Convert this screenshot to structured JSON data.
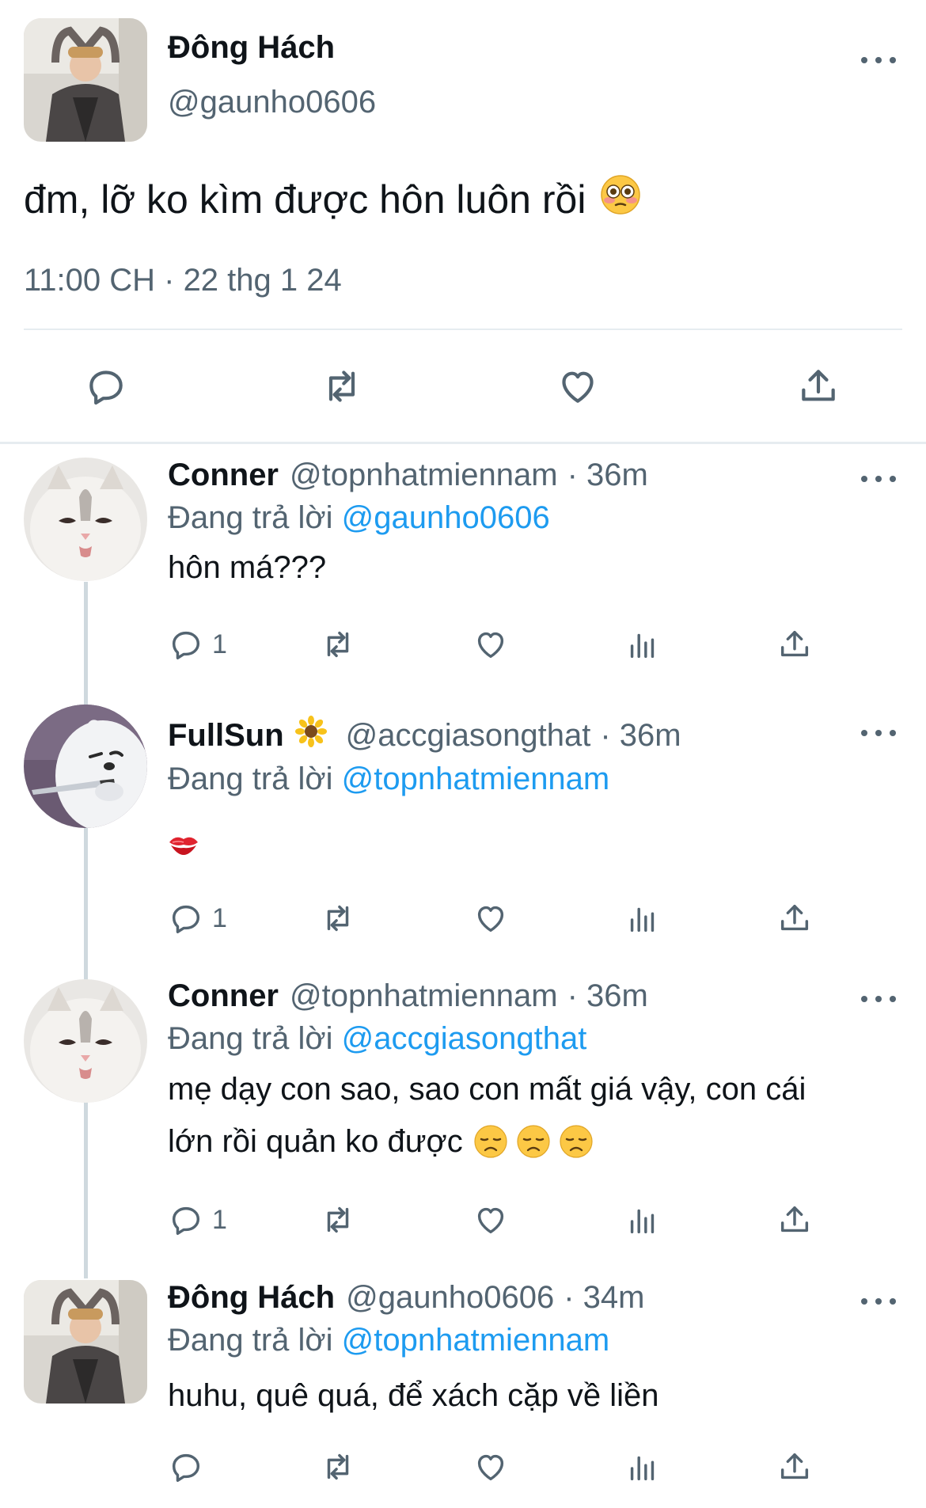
{
  "main_tweet": {
    "display_name": "Đông Hách",
    "handle": "@gaunho0606",
    "text": "đm, lỡ ko kìm được hôn luôn rồi",
    "emoji": "flushed-face",
    "timestamp": "11:00 CH · 22 thg 1 24",
    "actions": [
      "reply",
      "retweet",
      "like",
      "share"
    ]
  },
  "replies": [
    {
      "display_name": "Conner",
      "handle": "@topnhatmiennam",
      "time": "· 36m",
      "replying_prefix": "Đang trả lời",
      "replying_to": "@gaunho0606",
      "text": "hôn má???",
      "reply_count": "1"
    },
    {
      "display_name": "FullSun",
      "name_emoji": "sunflower",
      "handle": "@accgiasongthat",
      "time": "· 36m",
      "replying_prefix": "Đang trả lời",
      "replying_to": "@topnhatmiennam",
      "text": "",
      "emoji": "kiss-mark",
      "reply_count": "1"
    },
    {
      "display_name": "Conner",
      "handle": "@topnhatmiennam",
      "time": "· 36m",
      "replying_prefix": "Đang trả lời",
      "replying_to": "@accgiasongthat",
      "text_line1": "mẹ dạy con sao, sao con mất giá vậy, con cái",
      "text_line2": "lớn rồi quản ko được",
      "emoji": "disappointed-face x3",
      "reply_count": "1"
    },
    {
      "display_name": "Đông Hách",
      "handle": "@gaunho0606",
      "time": "· 34m",
      "replying_prefix": "Đang trả lời",
      "replying_to": "@topnhatmiennam",
      "text": "huhu, quê quá, để xách cặp về liền",
      "reply_count": ""
    }
  ],
  "colors": {
    "text": "#0f1419",
    "secondary": "#536471",
    "mention": "#1d9bf0",
    "divider": "#e6ecf0"
  }
}
